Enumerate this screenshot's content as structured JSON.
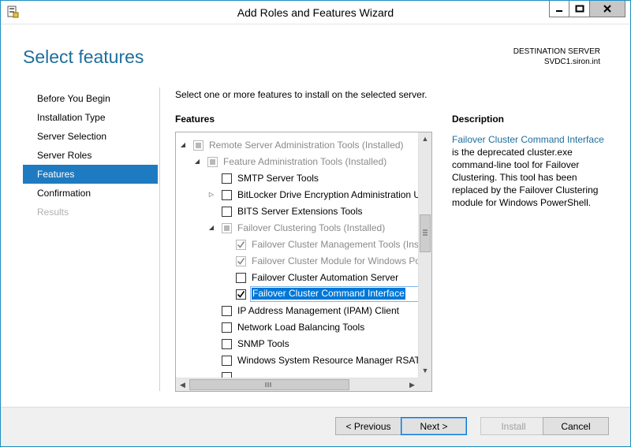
{
  "window": {
    "title": "Add Roles and Features Wizard",
    "controls": {
      "minimize": "minimize",
      "maximize": "maximize",
      "close": "close"
    }
  },
  "header": {
    "page_title": "Select features",
    "destination_label": "DESTINATION SERVER",
    "destination_value": "SVDC1.siron.int"
  },
  "nav": {
    "items": [
      {
        "label": "Before You Begin",
        "state": "normal"
      },
      {
        "label": "Installation Type",
        "state": "normal"
      },
      {
        "label": "Server Selection",
        "state": "normal"
      },
      {
        "label": "Server Roles",
        "state": "normal"
      },
      {
        "label": "Features",
        "state": "active"
      },
      {
        "label": "Confirmation",
        "state": "normal"
      },
      {
        "label": "Results",
        "state": "disabled"
      }
    ]
  },
  "main": {
    "intro": "Select one or more features to install on the selected server.",
    "features_heading": "Features",
    "tree": [
      {
        "label": "Remote Server Administration Tools (Installed)",
        "level": 0,
        "expander": "expanded",
        "check": "partial",
        "muted": true
      },
      {
        "label": "Feature Administration Tools (Installed)",
        "level": 1,
        "expander": "expanded",
        "check": "partial",
        "muted": true
      },
      {
        "label": "SMTP Server Tools",
        "level": 2,
        "expander": "none",
        "check": "unchecked",
        "muted": false
      },
      {
        "label": "BitLocker Drive Encryption Administration U",
        "level": 2,
        "expander": "collapsed",
        "check": "unchecked",
        "muted": false
      },
      {
        "label": "BITS Server Extensions Tools",
        "level": 2,
        "expander": "none",
        "check": "unchecked",
        "muted": false
      },
      {
        "label": "Failover Clustering Tools (Installed)",
        "level": 2,
        "expander": "expanded",
        "check": "partial",
        "muted": true
      },
      {
        "label": "Failover Cluster Management Tools (Inst",
        "level": 3,
        "expander": "none",
        "check": "checked-gray",
        "muted": true
      },
      {
        "label": "Failover Cluster Module for Windows Po",
        "level": 3,
        "expander": "none",
        "check": "checked-gray",
        "muted": true
      },
      {
        "label": "Failover Cluster Automation Server",
        "level": 3,
        "expander": "none",
        "check": "unchecked",
        "muted": false
      },
      {
        "label": "Failover Cluster Command Interface",
        "level": 3,
        "expander": "none",
        "check": "checked",
        "muted": false,
        "selected": true
      },
      {
        "label": "IP Address Management (IPAM) Client",
        "level": 2,
        "expander": "none",
        "check": "unchecked",
        "muted": false
      },
      {
        "label": "Network Load Balancing Tools",
        "level": 2,
        "expander": "none",
        "check": "unchecked",
        "muted": false
      },
      {
        "label": "SNMP Tools",
        "level": 2,
        "expander": "none",
        "check": "unchecked",
        "muted": false
      },
      {
        "label": "Windows System Resource Manager RSAT",
        "level": 2,
        "expander": "none",
        "check": "unchecked",
        "muted": false
      }
    ]
  },
  "description": {
    "heading": "Description",
    "feature_name": "Failover Cluster Command Interface",
    "text": " is the deprecated cluster.exe command-line tool for Failover Clustering. This tool has been replaced by the Failover Clustering module for Windows PowerShell."
  },
  "footer": {
    "previous": "< Previous",
    "next": "Next >",
    "install": "Install",
    "cancel": "Cancel"
  },
  "colors": {
    "accent": "#1e7bc2",
    "title_blue": "#1e6e9c",
    "selection": "#0078d7"
  }
}
